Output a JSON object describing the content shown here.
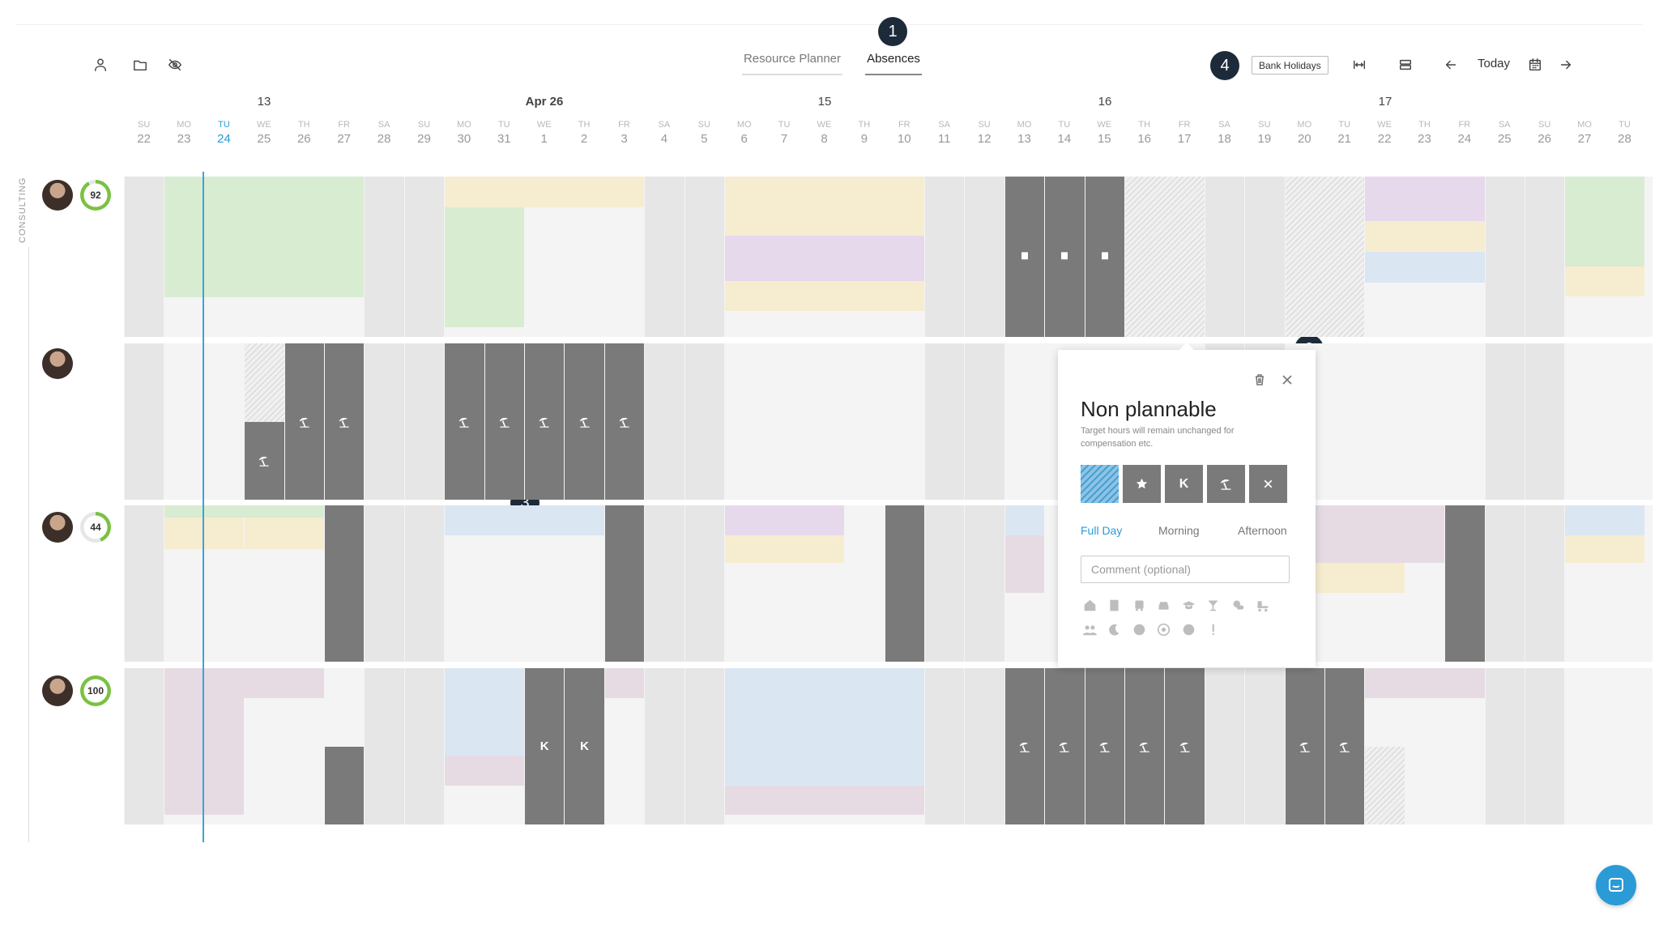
{
  "tabs": [
    {
      "label": "Resource Planner"
    },
    {
      "label": "Absences"
    }
  ],
  "badges": [
    "1",
    "2",
    "3",
    "4"
  ],
  "toolbar": {
    "bank_holidays": "Bank Holidays",
    "today": "Today"
  },
  "months": [
    "13",
    "Apr 26",
    "15",
    "16",
    "17"
  ],
  "days": [
    {
      "n": "SU",
      "d": "22"
    },
    {
      "n": "MO",
      "d": "23"
    },
    {
      "n": "TU",
      "d": "24"
    },
    {
      "n": "WE",
      "d": "25"
    },
    {
      "n": "TH",
      "d": "26"
    },
    {
      "n": "FR",
      "d": "27"
    },
    {
      "n": "SA",
      "d": "28"
    },
    {
      "n": "SU",
      "d": "29"
    },
    {
      "n": "MO",
      "d": "30"
    },
    {
      "n": "TU",
      "d": "31"
    },
    {
      "n": "WE",
      "d": "1"
    },
    {
      "n": "TH",
      "d": "2"
    },
    {
      "n": "FR",
      "d": "3"
    },
    {
      "n": "SA",
      "d": "4"
    },
    {
      "n": "SU",
      "d": "5"
    },
    {
      "n": "MO",
      "d": "6"
    },
    {
      "n": "TU",
      "d": "7"
    },
    {
      "n": "WE",
      "d": "8"
    },
    {
      "n": "TH",
      "d": "9"
    },
    {
      "n": "FR",
      "d": "10"
    },
    {
      "n": "SA",
      "d": "11"
    },
    {
      "n": "SU",
      "d": "12"
    },
    {
      "n": "MO",
      "d": "13"
    },
    {
      "n": "TU",
      "d": "14"
    },
    {
      "n": "WE",
      "d": "15"
    },
    {
      "n": "TH",
      "d": "16"
    },
    {
      "n": "FR",
      "d": "17"
    },
    {
      "n": "SA",
      "d": "18"
    },
    {
      "n": "SU",
      "d": "19"
    },
    {
      "n": "MO",
      "d": "20"
    },
    {
      "n": "TU",
      "d": "21"
    },
    {
      "n": "WE",
      "d": "22"
    },
    {
      "n": "TH",
      "d": "23"
    },
    {
      "n": "FR",
      "d": "24"
    },
    {
      "n": "SA",
      "d": "25"
    },
    {
      "n": "SU",
      "d": "26"
    },
    {
      "n": "MO",
      "d": "27"
    },
    {
      "n": "TU",
      "d": "28"
    }
  ],
  "today_index": 2,
  "team_label": "CONSULTING",
  "people": [
    {
      "score": "92",
      "score_fraction": 0.92
    },
    {
      "score": ""
    },
    {
      "score": "44",
      "score_fraction": 0.44
    },
    {
      "score": "100",
      "score_fraction": 1.0
    }
  ],
  "dark_labels": {
    "k": "K"
  },
  "popup": {
    "title": "Non plannable",
    "subtitle": "Target hours will remain unchanged for compensation etc.",
    "options": [
      "Full Day",
      "Morning",
      "Afternoon"
    ],
    "comment_placeholder": "Comment (optional)",
    "type_k": "K"
  },
  "colors": {
    "accent": "#2a9bd6",
    "green": "#d8ecd2",
    "yellow": "#f6ecd0",
    "purple": "#e7d9ec",
    "blue": "#dbe6f3",
    "mauve": "#e6dbe3",
    "dark": "#7a7a7a"
  }
}
